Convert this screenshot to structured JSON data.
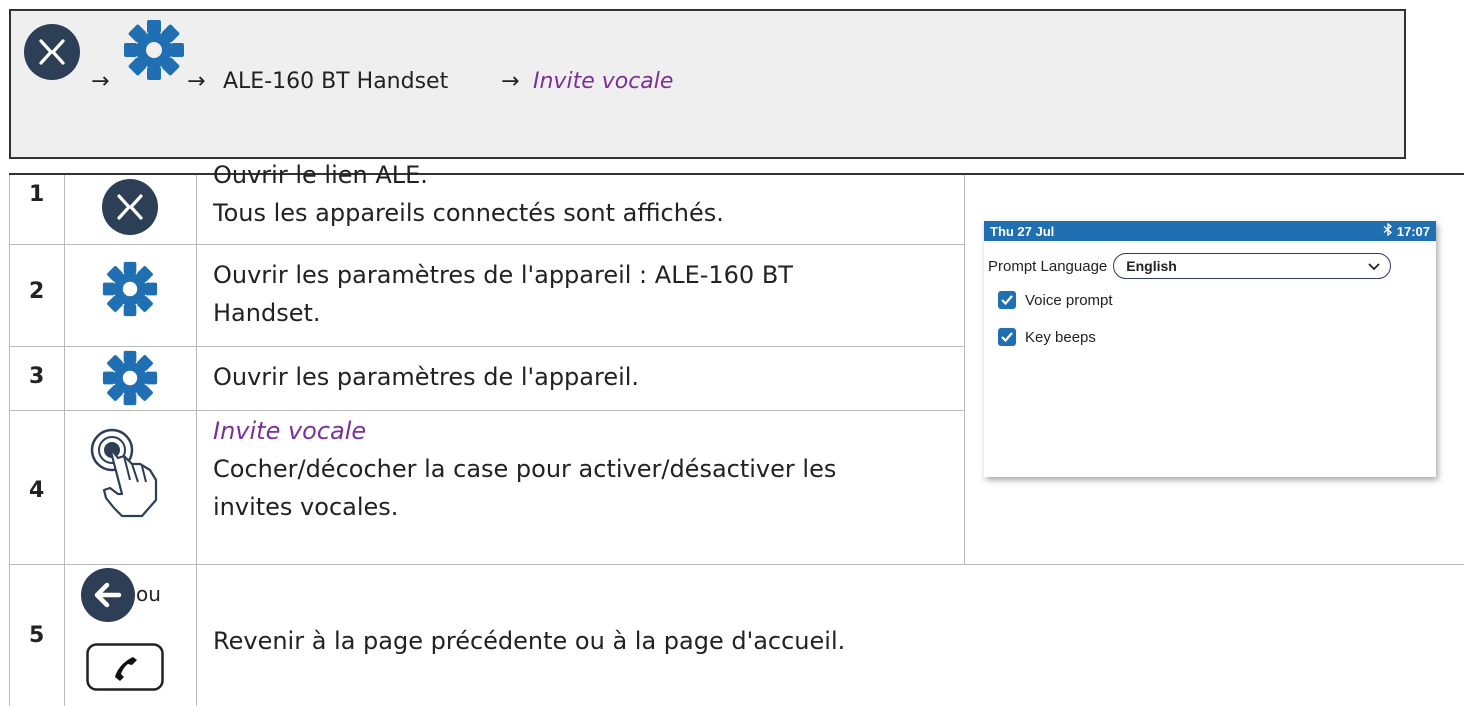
{
  "breadcrumb": {
    "arrow": "→",
    "device": "ALE-160 BT Handset",
    "link": "Invite vocale"
  },
  "steps": [
    {
      "num": "1",
      "lines": [
        "Ouvrir le lien ALE.",
        "Tous les appareils connectés sont affichés."
      ]
    },
    {
      "num": "2",
      "lines": [
        "Ouvrir les paramètres de l'appareil : ALE-160 BT",
        "Handset."
      ]
    },
    {
      "num": "3",
      "lines": [
        "Ouvrir les paramètres de l'appareil."
      ]
    },
    {
      "num": "4",
      "title": "Invite vocale",
      "lines": [
        "Cocher/décocher la case pour activer/désactiver les",
        "invites vocales."
      ]
    },
    {
      "num": "5",
      "or": "ou",
      "lines": [
        "Revenir à la page précédente ou à la page d'accueil."
      ]
    }
  ],
  "screen": {
    "date": "Thu 27 Jul",
    "bluetooth_icon": "bluetooth-icon",
    "time": "17:07",
    "prompt_label": "Prompt Language",
    "language": "English",
    "voice_prompt": {
      "label": "Voice prompt",
      "checked": true
    },
    "key_beeps": {
      "label": "Key beeps",
      "checked": true
    }
  },
  "colors": {
    "accent_blue": "#1f6fb2",
    "icon_navy": "#2d3e57",
    "link_purple": "#7b2f9a"
  }
}
